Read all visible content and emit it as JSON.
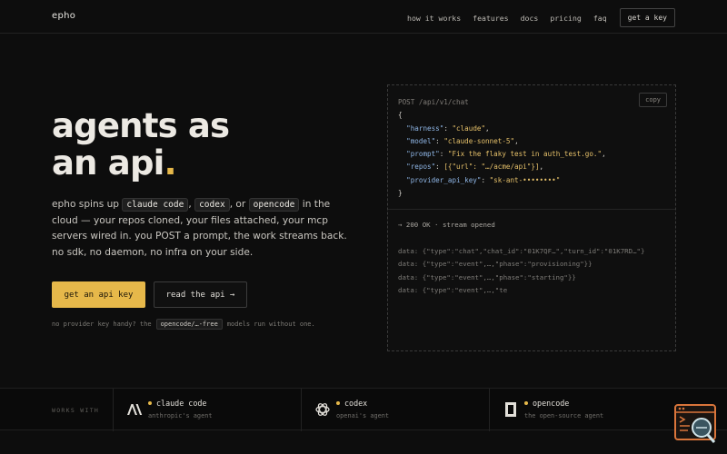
{
  "brand": {
    "logo": "epho"
  },
  "nav": {
    "links": [
      "how it works",
      "features",
      "docs",
      "pricing",
      "faq"
    ],
    "cta": "get a key"
  },
  "hero": {
    "title_line1": "agents as",
    "title_line2": "an api",
    "title_dot": ".",
    "desc_1": "epho spins up ",
    "pill_1": "claude code",
    "desc_sep1": ",",
    "pill_2": "codex",
    "desc_sep2": ", or",
    "pill_3": "opencode",
    "desc_2": " in the cloud — your repos cloned, your files attached, your mcp servers wired in. you POST a prompt, the work streams back. no sdk, no daemon, no infra on your side.",
    "primary_button": "get an api key",
    "secondary_button": "read the api →",
    "note_before": "no provider key handy? the",
    "note_pill": "opencode/…-free",
    "note_after": "models run without one."
  },
  "code_panel": {
    "copy_label": "copy",
    "request_line": "POST /api/v1/chat",
    "open_brace": "{",
    "close_brace": "}",
    "fields": [
      {
        "key": "\"harness\"",
        "value": "\"claude\"",
        "trail": ","
      },
      {
        "key": "\"model\"",
        "value": "\"claude-sonnet-5\"",
        "trail": ","
      },
      {
        "key": "\"prompt\"",
        "value": "\"Fix the flaky test in auth_test.go.\"",
        "trail": ","
      },
      {
        "key": "\"repos\"",
        "value": "[{\"url\": \"…/acme/api\"}]",
        "trail": ","
      },
      {
        "key": "\"provider_api_key\"",
        "value": "\"sk-ant-••••••••\"",
        "trail": ""
      }
    ],
    "status_line": "→ 200 OK · stream opened",
    "stream_lines": [
      "data: {\"type\":\"chat\",\"chat_id\":\"01K7QF…\",\"turn_id\":\"01K7RD…\"}",
      "data: {\"type\":\"event\",…,\"phase\":\"provisioning\"}}",
      "data: {\"type\":\"event\",…,\"phase\":\"starting\"}}",
      "data: {\"type\":\"event\",…,\"te"
    ]
  },
  "works_with": {
    "label": "WORKS WITH",
    "agents": [
      {
        "name": "claude code",
        "sub": "anthropic's agent",
        "icon": "anthropic-icon"
      },
      {
        "name": "codex",
        "sub": "openai's agent",
        "icon": "openai-icon"
      },
      {
        "name": "opencode",
        "sub": "the open-source agent",
        "icon": "opencode-icon"
      }
    ]
  },
  "colors": {
    "accent": "#e6b84a",
    "background": "#0d0d0d",
    "json_key": "#8fb6e6"
  }
}
